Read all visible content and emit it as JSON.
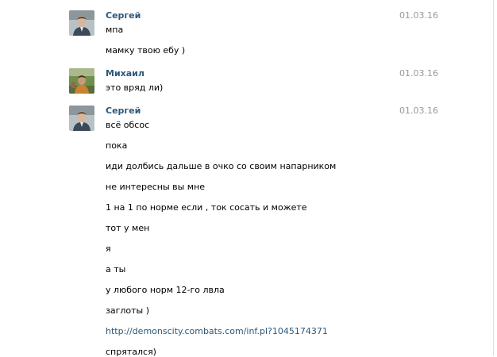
{
  "messages": [
    {
      "author": "Сергей",
      "avatar_icon": "user-avatar-sergey",
      "date": "01.03.16",
      "lines": [
        "мпа",
        "мамку твою ебу )"
      ]
    },
    {
      "author": "Михаил",
      "avatar_icon": "user-avatar-mikhail",
      "date": "01.03.16",
      "lines": [
        "это вряд ли)"
      ]
    },
    {
      "author": "Сергей",
      "avatar_icon": "user-avatar-sergey",
      "date": "01.03.16",
      "lines": [
        "всё обсос",
        "пока",
        "иди долбись дальше в очко со своим напарником",
        "не интересны вы мне",
        "1 на 1 по норме если , ток сосать и можете",
        "тот у мен",
        "я",
        "а ты",
        "у любого норм 12-го лвла",
        "заглоты )",
        "http://demonscity.combats.com/inf.pl?1045174371",
        "спрятался)"
      ]
    }
  ],
  "colors": {
    "author": "#2b587a",
    "date": "#999999",
    "link": "#2b587a"
  }
}
